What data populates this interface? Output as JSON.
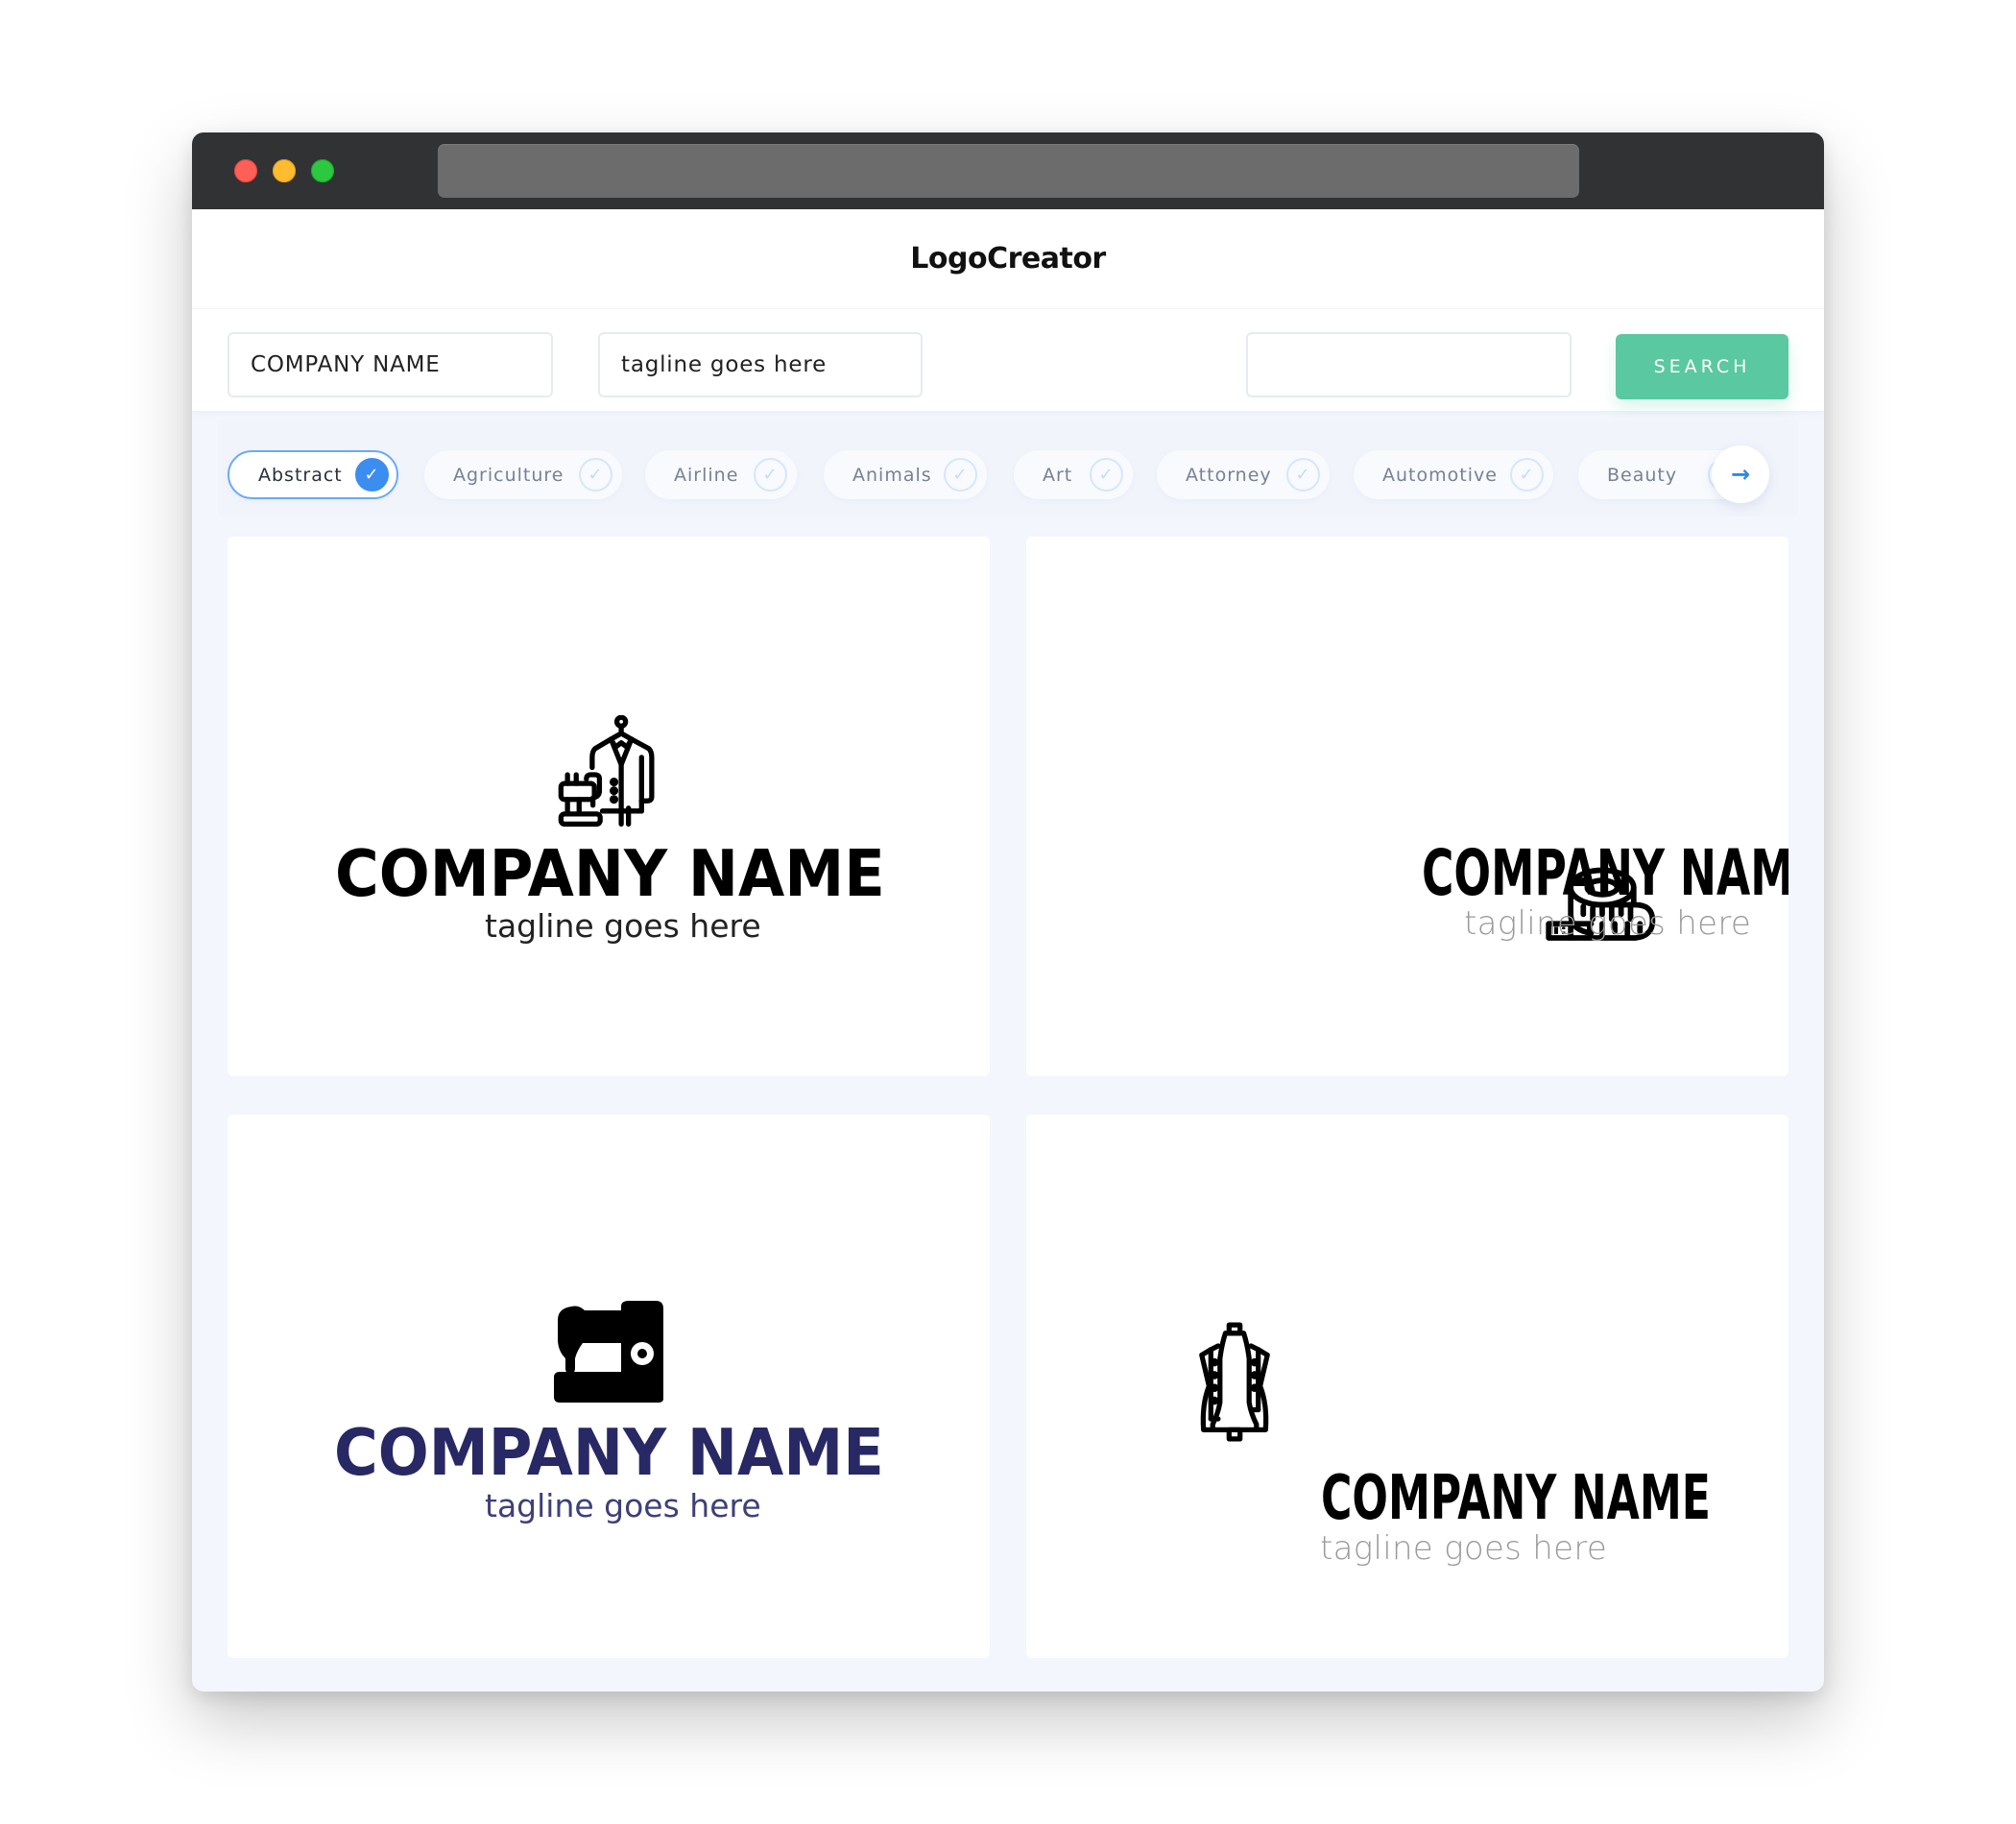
{
  "window": {
    "traffic_lights": [
      "close",
      "minimize",
      "maximize"
    ],
    "url": ""
  },
  "header": {
    "title": "LogoCreator"
  },
  "search": {
    "company_value": "COMPANY NAME",
    "tagline_value": "tagline goes here",
    "extra_value": "",
    "button_label": "SEARCH"
  },
  "categories": {
    "items": [
      {
        "label": "Abstract",
        "selected": true
      },
      {
        "label": "Agriculture",
        "selected": false
      },
      {
        "label": "Airline",
        "selected": false
      },
      {
        "label": "Animals",
        "selected": false
      },
      {
        "label": "Art",
        "selected": false
      },
      {
        "label": "Attorney",
        "selected": false
      },
      {
        "label": "Automotive",
        "selected": false
      },
      {
        "label": "Beauty",
        "selected": false
      }
    ],
    "check_icon": "✓",
    "next_icon": "→"
  },
  "cards": [
    {
      "company": "COMPANY NAME",
      "tagline": "tagline goes here",
      "icon": "coat-and-sewing-machine-icon",
      "name_color": "#000000",
      "tagline_color": "#222222"
    },
    {
      "company": "COMPANY NAME",
      "tagline": "tagline goes here",
      "icon": "tape-measure-icon",
      "name_color": "#000000",
      "tagline_color": "#9A9A9A"
    },
    {
      "company": "COMPANY NAME",
      "tagline": "tagline goes here",
      "icon": "sewing-machine-icon",
      "name_color": "#272864",
      "tagline_color": "#3E3F7A"
    },
    {
      "company": "COMPANY NAME",
      "tagline": "tagline goes here",
      "icon": "dress-form-icon",
      "name_color": "#000000",
      "tagline_color": "#9A9A9A"
    }
  ],
  "colors": {
    "accent": "#3C8DF0",
    "search_button": "#5AC8A0",
    "titlebar": "#313234",
    "page_bg": "#F3F6FC"
  }
}
